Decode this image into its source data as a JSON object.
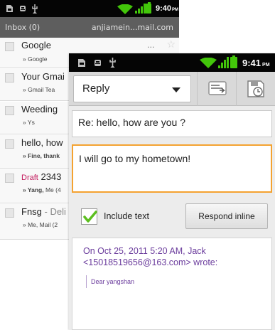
{
  "back_screen": {
    "status_bar": {
      "time": "9:40",
      "ampm": "PM"
    },
    "header": {
      "title": "Inbox (0)",
      "account": "anjiamein...mail.com"
    },
    "messages": [
      {
        "subject": "Google",
        "suffix": "",
        "from": "» Google",
        "from_bold": "",
        "from_rest": "",
        "trail": "...",
        "draft": ""
      },
      {
        "subject": "Your Gmai",
        "suffix": "",
        "from": "» Gmail Tea",
        "from_bold": "",
        "from_rest": "",
        "trail": "",
        "draft": ""
      },
      {
        "subject": "Weeding",
        "suffix": "",
        "from": "» Ys",
        "from_bold": "",
        "from_rest": "",
        "trail": "",
        "draft": ""
      },
      {
        "subject": "hello, how",
        "suffix": "",
        "from": "",
        "from_bold": "» Fine, thank",
        "from_rest": "",
        "trail": "",
        "draft": ""
      },
      {
        "subject": "2343",
        "suffix": "",
        "from": "",
        "from_bold": "» Yang,",
        "from_rest": " Me (4",
        "trail": "",
        "draft": "Draft"
      },
      {
        "subject": "Fnsg",
        "suffix": " - Deli",
        "from": "» Me, Mail (2",
        "from_bold": "",
        "from_rest": "",
        "trail": "",
        "draft": ""
      }
    ]
  },
  "front_screen": {
    "status_bar": {
      "time": "9:41",
      "ampm": "PM"
    },
    "mode": {
      "label": "Reply"
    },
    "subject_value": "Re: hello, how are you ?",
    "body_value": "I will go to my hometown!",
    "include_text": {
      "label": "Include text",
      "checked": true
    },
    "respond_inline_label": "Respond inline",
    "quote": {
      "header": "On Oct 25, 2011 5:20 AM, Jack <15018519656@163.com> wrote:",
      "text": "Dear  yangshan"
    }
  },
  "colors": {
    "accent_orange": "#f4a230",
    "quote_purple": "#6a3b9c",
    "draft_pink": "#c2185b",
    "signal_green": "#42c50a",
    "header_gray": "#5e5e5e"
  },
  "icons": [
    "sd-card-icon",
    "usb-debug-icon",
    "usb-icon",
    "wifi-icon",
    "signal-icon",
    "battery-charging-icon",
    "star-icon",
    "send-icon",
    "save-later-icon",
    "caret-down-icon",
    "checkmark-icon"
  ]
}
